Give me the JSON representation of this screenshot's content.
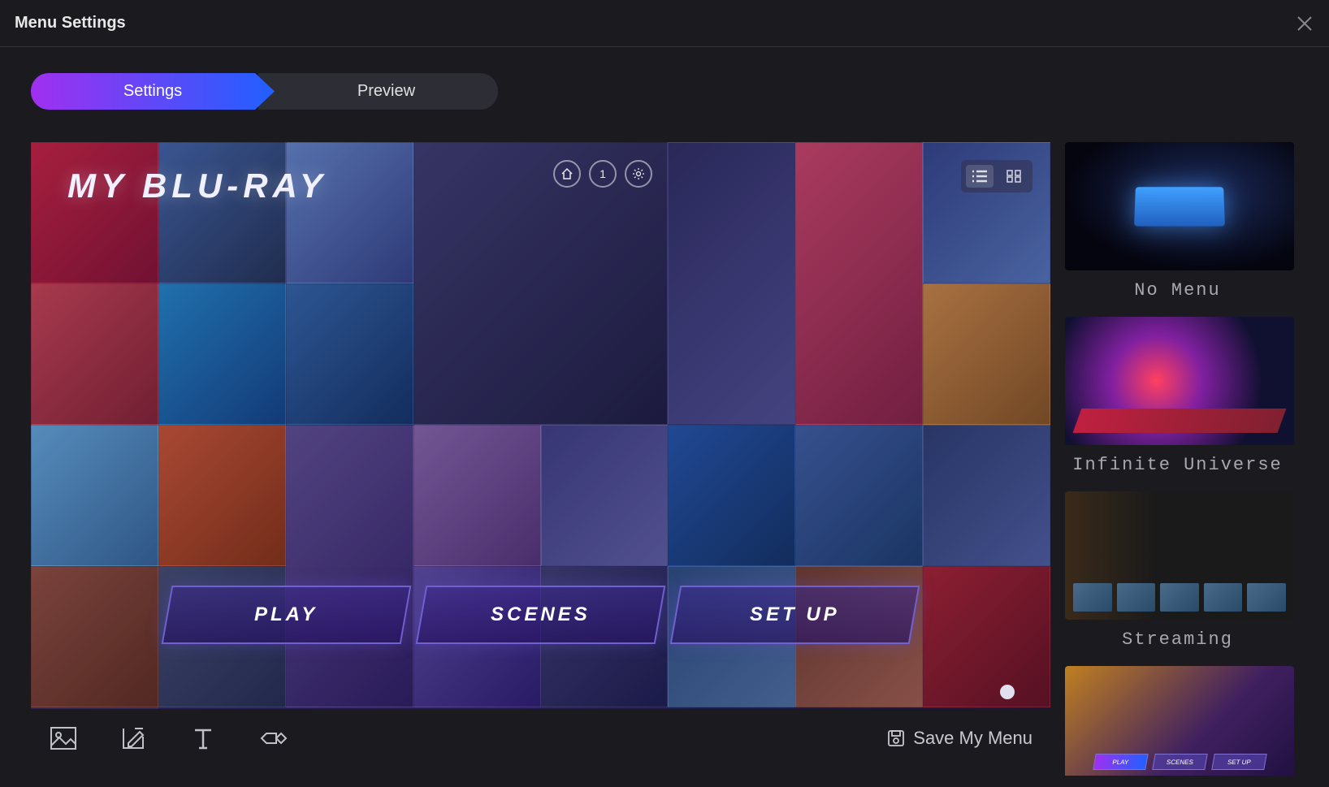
{
  "header": {
    "title": "Menu Settings"
  },
  "tabs": {
    "settings": "Settings",
    "preview": "Preview"
  },
  "preview": {
    "title": "MY BLU-RAY",
    "page_number": "1",
    "menu_buttons": {
      "play": "PLAY",
      "scenes": "SCENES",
      "setup": "SET UP"
    }
  },
  "toolbar": {
    "save_label": "Save My Menu"
  },
  "templates": {
    "item1": "No Menu",
    "item2": "Infinite Universe",
    "item3": "Streaming"
  },
  "partial_btns": {
    "b1": "PLAY",
    "b2": "SCENES",
    "b3": "SET UP"
  }
}
